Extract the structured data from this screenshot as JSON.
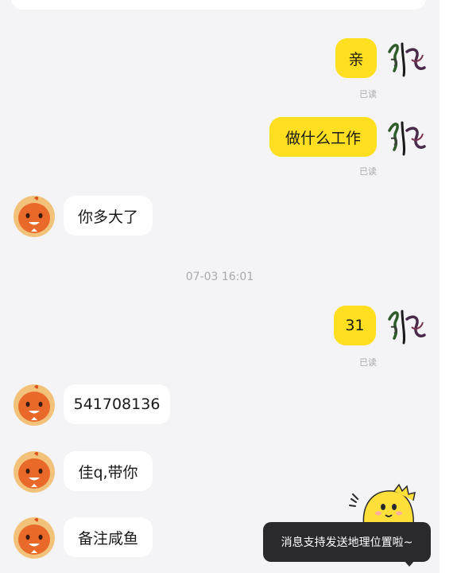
{
  "messages": [
    {
      "id": "m1",
      "text": "亲",
      "read": "已读"
    },
    {
      "id": "m2",
      "text": "做什么工作",
      "read": "已读"
    },
    {
      "id": "m3",
      "text": "你多大了"
    },
    {
      "id": "m4",
      "text": "31",
      "read": "已读"
    },
    {
      "id": "m5",
      "text": "541708136"
    },
    {
      "id": "m6",
      "text": "佳q,带你"
    },
    {
      "id": "m7",
      "text": "备注咸鱼"
    }
  ],
  "timestamp": "07-03 16:01",
  "toast": {
    "text": "消息支持发送地理位置啦~"
  },
  "colors": {
    "outgoing_bubble": "#ffdf1f",
    "incoming_bubble": "#ffffff",
    "background": "#f4f4f6",
    "toast": "#2a2a2e"
  },
  "icons": {
    "self_avatar": "calligraphy-avatar",
    "other_avatar": "orange-cartoon-avatar",
    "mascot": "yellow-fish-mascot"
  }
}
